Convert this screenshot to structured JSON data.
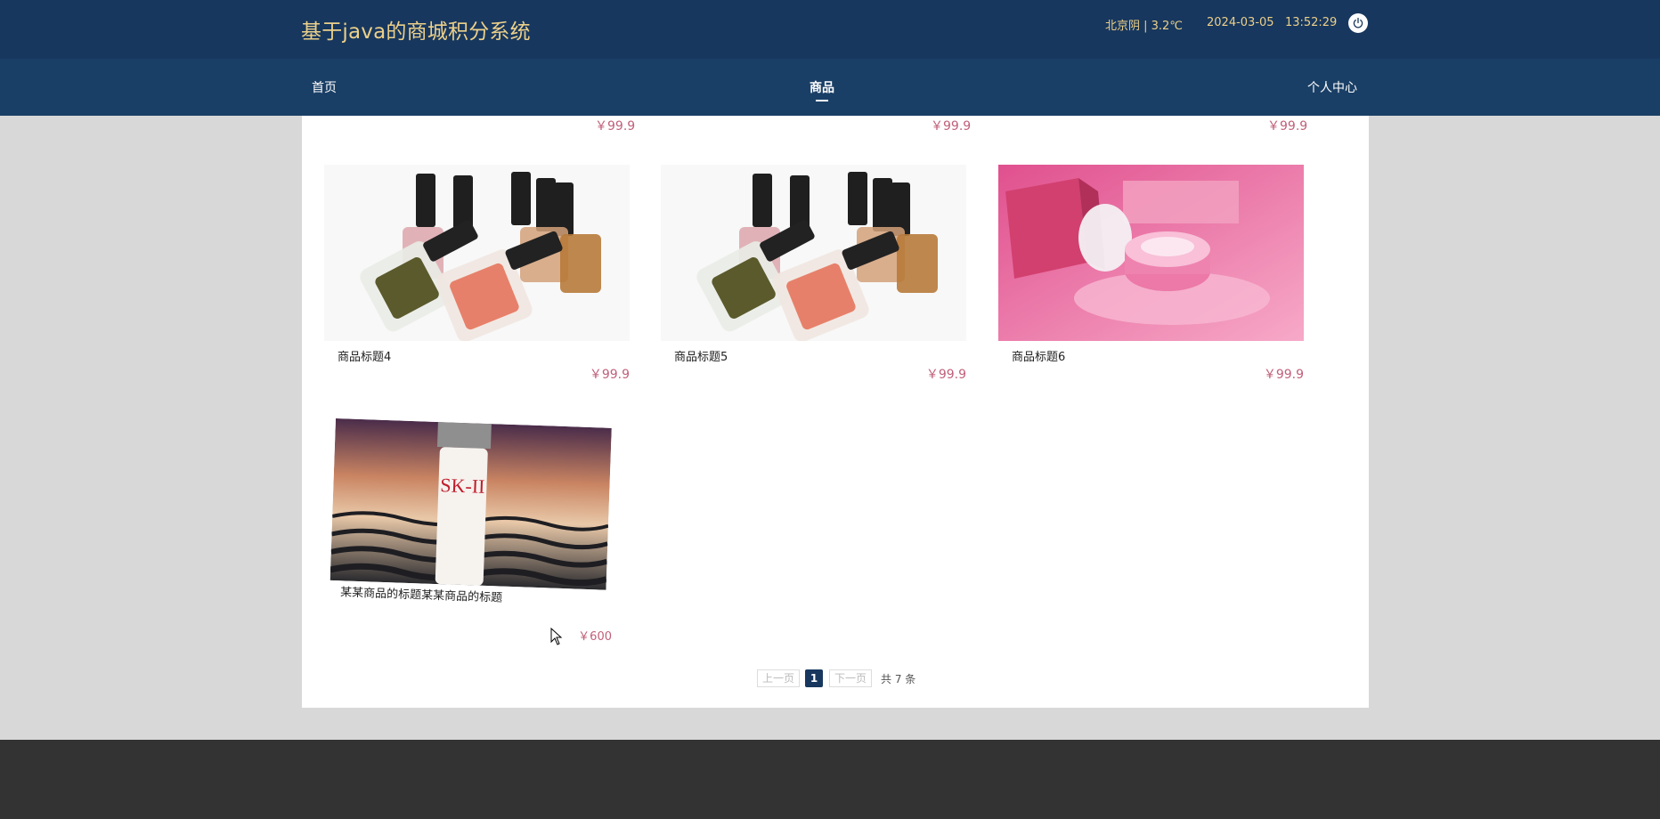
{
  "header": {
    "title": "基于java的商城积分系统",
    "weather": "北京阴 | 3.2℃",
    "datetime": "2024-03-05   13:52:29",
    "power_icon": "power-icon"
  },
  "nav": {
    "items": [
      {
        "label": "首页"
      },
      {
        "label": "商品",
        "active": true
      },
      {
        "label": "个人中心"
      }
    ]
  },
  "products": {
    "top_row_prices": [
      "￥99.9",
      "￥99.9",
      "￥99.9"
    ],
    "items": [
      {
        "title": "商品标题4",
        "price": "￥99.9",
        "image": "nail-polish-bottles"
      },
      {
        "title": "商品标题5",
        "price": "￥99.9",
        "image": "nail-polish-bottles"
      },
      {
        "title": "商品标题6",
        "price": "￥99.9",
        "image": "pink-cleansing-balm"
      },
      {
        "title": "某某商品的标题某某商品的标题",
        "price": "￥600",
        "image": "skincare-essence-bottle"
      }
    ]
  },
  "pagination": {
    "prev": "上一页",
    "current": "1",
    "next": "下一页",
    "total": "共 7 条"
  },
  "colors": {
    "header_bg": "#17375e",
    "nav_bg": "#1a3f66",
    "title_color": "#ecd08a",
    "price_color": "#c0607a",
    "footer_bg": "#333333"
  }
}
